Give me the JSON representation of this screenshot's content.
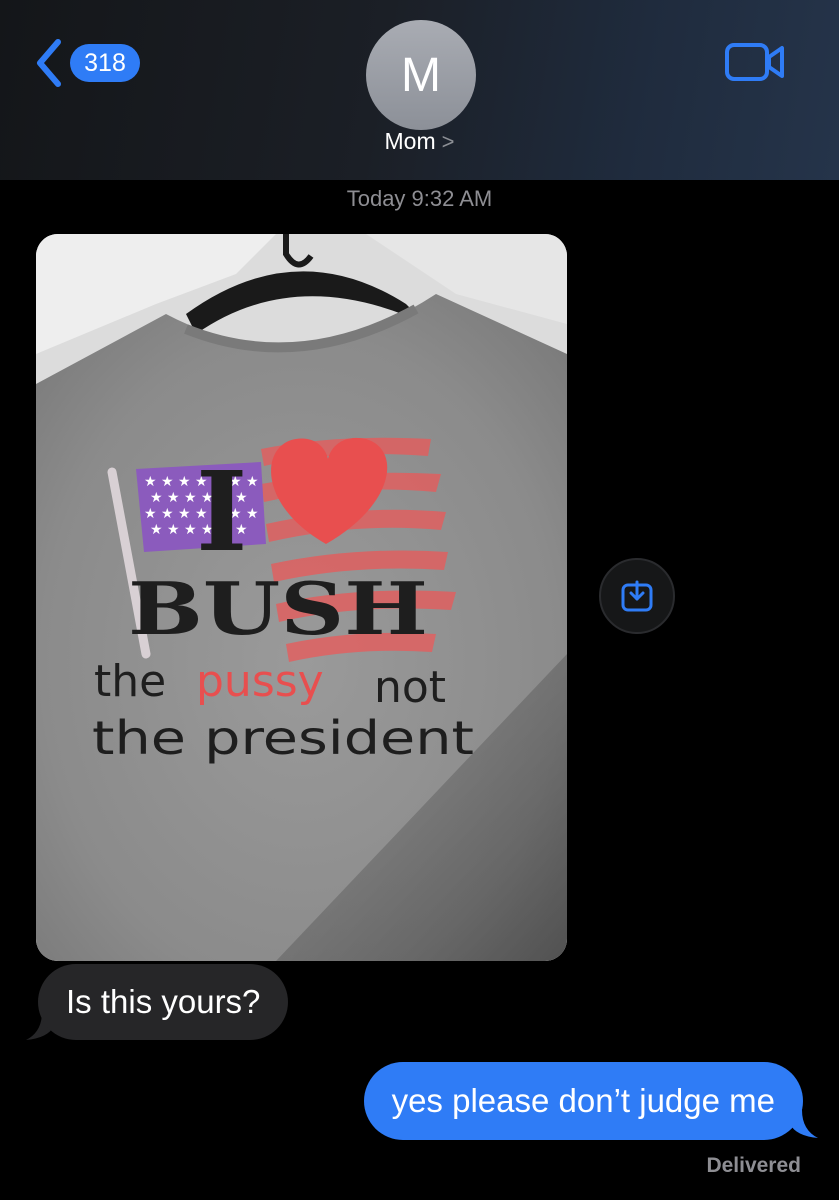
{
  "nav": {
    "back_count": "318",
    "avatar_initial": "M",
    "contact_name": "Mom",
    "contact_chevron": ">",
    "video_icon": "video-camera-icon"
  },
  "thread": {
    "timestamp": "Today 9:32 AM",
    "photo": {
      "shirt_text": {
        "line1": "I",
        "line2": "BUSH",
        "line3_a": "the",
        "line3_b": "pussy",
        "line3_c": "not",
        "line4": "the president"
      }
    },
    "save_icon": "download-icon",
    "received_message": "Is this yours?",
    "sent_message": "yes please don’t judge me",
    "status": "Delivered"
  },
  "colors": {
    "accent": "#2f7cf6",
    "received_bubble": "#262628",
    "background": "#000000",
    "heart": "#e84f4f",
    "flag_stars": "#8b5bbd"
  }
}
